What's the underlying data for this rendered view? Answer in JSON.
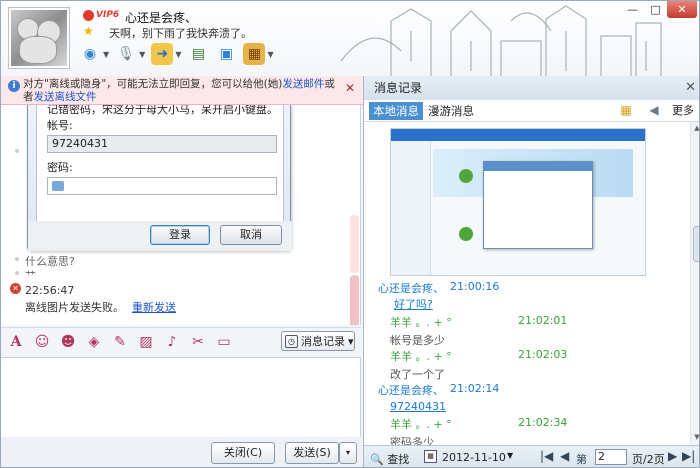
{
  "header": {
    "vip_label": "VIP6",
    "nickname": "心还是会疼、",
    "signature": "天啊，别下雨了我快奔溃了。",
    "window_controls": {
      "min": "—",
      "max": "□",
      "close": "✕"
    }
  },
  "notice": {
    "info_icon": "i",
    "text_before": "对方\"离线或隐身\"，可能无法立即回复，您可以给他(她)",
    "link1": "发送邮件",
    "text_mid": "或者",
    "link2": "发送离线文件",
    "close": "✕"
  },
  "chat": {
    "dialog": {
      "hint": "记错密码，宋这分于母大小马，呆开启小键盘。",
      "account_label": "帐号:",
      "account_value": "97240431",
      "password_label": "密码:",
      "login_button": "登录",
      "cancel_button": "取消"
    },
    "messages": [
      {
        "text": "什么意思?"
      },
      {
        "text": "艹"
      },
      {
        "error_icon": "✕",
        "text": "22:56:47"
      },
      {
        "text": "离线图片发送失败。",
        "link": "重新发送"
      }
    ]
  },
  "toolbar_format": {
    "history_button": "消息记录",
    "history_dropdown": "▾"
  },
  "bottom": {
    "close_button": "关闭(C)",
    "send_button": "发送(S)",
    "send_dropdown": "▾"
  },
  "history": {
    "title": "消息记录",
    "close": "✕",
    "tab_local": "本地消息",
    "tab_roam": "漫游消息",
    "more": "更多",
    "entries": [
      {
        "sender": "心还是会疼、",
        "time": "21:00:16",
        "text": "好了吗?"
      },
      {
        "sender": "羊羊  。. + °",
        "time": "21:02:01",
        "text": "帐号是多少"
      },
      {
        "sender": "羊羊  。. + °",
        "time": "21:02:03",
        "text": "改了一个了"
      },
      {
        "sender": "心还是会疼、",
        "time": "21:02:14",
        "text": "97240431"
      },
      {
        "sender": "羊羊  。. + °",
        "time": "21:02:34",
        "text": "密码多少"
      }
    ],
    "footer": {
      "search": "查找",
      "date": "2012-11-10",
      "page_prefix": "第",
      "page_value": "2",
      "page_total": "页/2页"
    }
  },
  "colors": {
    "accent": "#4a8fd3",
    "notice_bg": "#fce7ea",
    "link": "#1a56c7",
    "green_sender": "#3aa33a",
    "blue_sender": "#1c7ad6"
  }
}
